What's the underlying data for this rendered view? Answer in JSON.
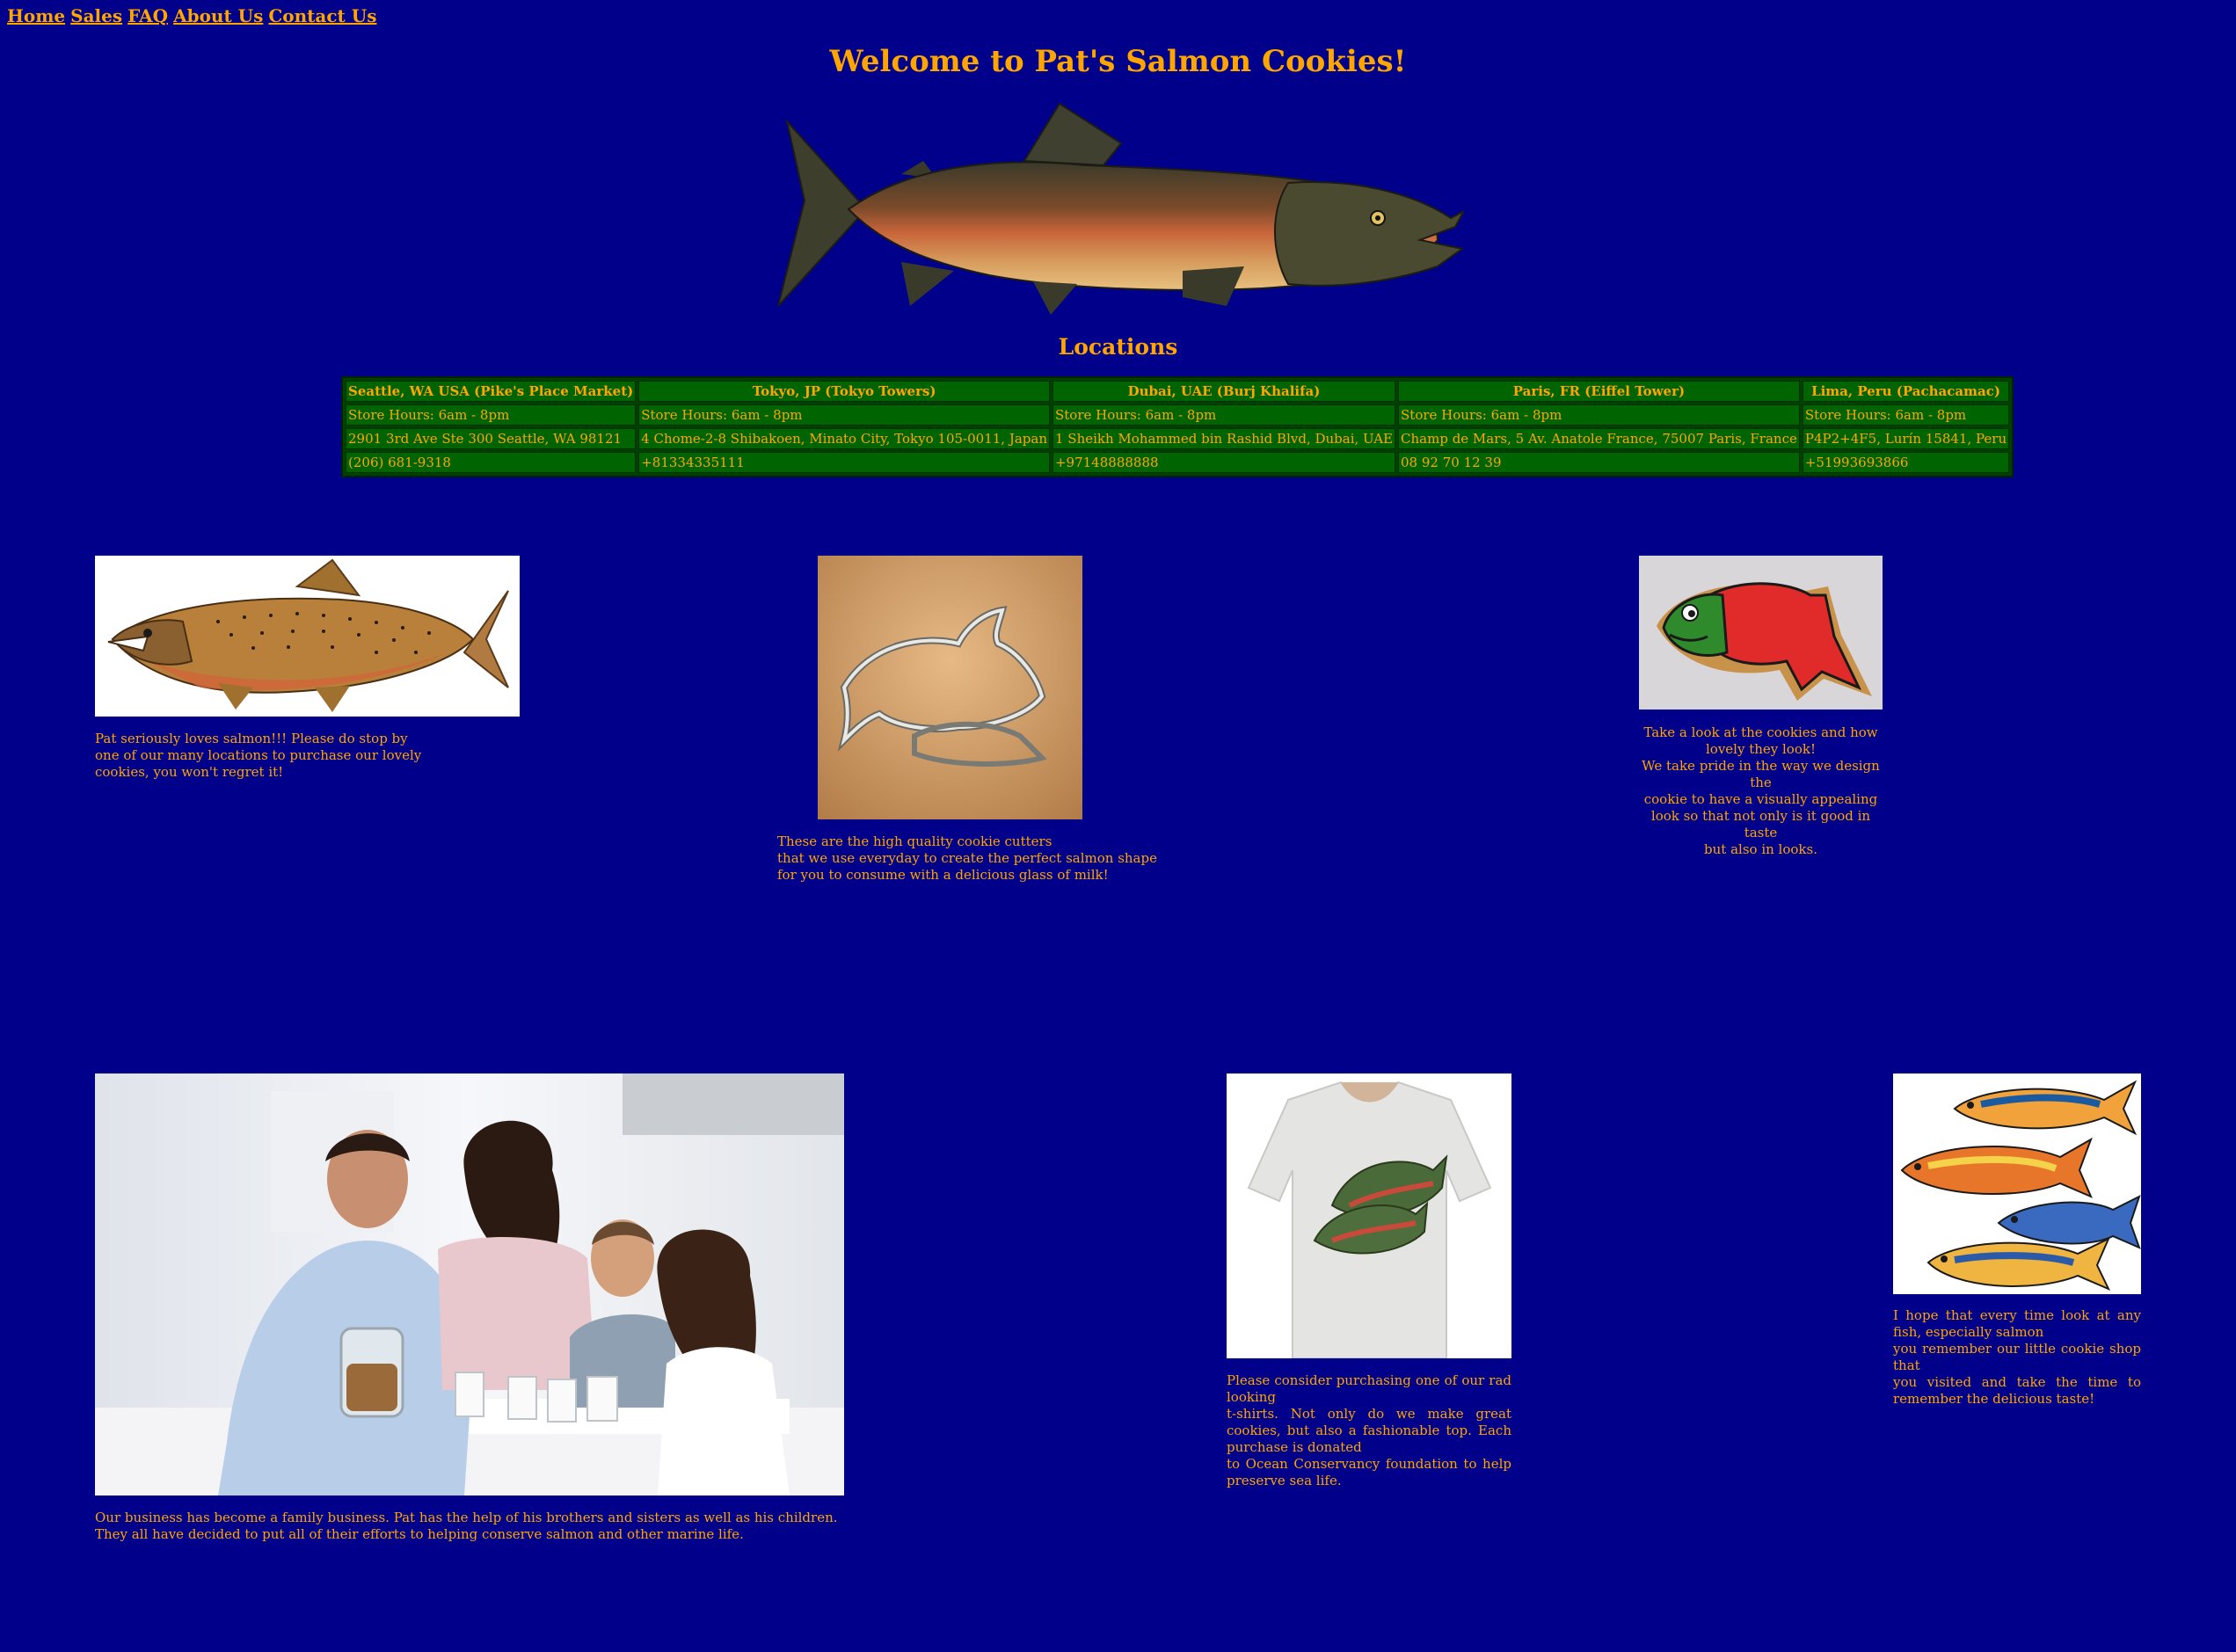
{
  "nav": {
    "links": [
      "Home",
      "Sales",
      "FAQ",
      "About Us",
      "Contact Us"
    ]
  },
  "header": {
    "title": "Welcome to Pat's Salmon Cookies!"
  },
  "locations": {
    "title": "Locations",
    "stores": [
      {
        "name": "Seattle, WA USA (Pike's Place Market)",
        "hours": "Store Hours: 6am - 8pm",
        "address": "2901 3rd Ave Ste 300 Seattle, WA 98121",
        "phone": "(206) 681-9318"
      },
      {
        "name": "Tokyo, JP (Tokyo Towers)",
        "hours": "Store Hours: 6am - 8pm",
        "address": "4 Chome-2-8 Shibakoen, Minato City, Tokyo 105-0011, Japan",
        "phone": "+81334335111"
      },
      {
        "name": "Dubai, UAE (Burj Khalifa)",
        "hours": "Store Hours: 6am - 8pm",
        "address": "1 Sheikh Mohammed bin Rashid Blvd, Dubai, UAE",
        "phone": "+97148888888"
      },
      {
        "name": "Paris, FR (Eiffel Tower)",
        "hours": "Store Hours: 6am - 8pm",
        "address": "Champ de Mars, 5 Av. Anatole France, 75007 Paris, France",
        "phone": "08 92 70 12 39"
      },
      {
        "name": "Lima, Peru (Pachacamac)",
        "hours": "Store Hours: 6am - 8pm",
        "address": "P4P2+4F5, Lurín 15841, Peru",
        "phone": "+51993693866"
      }
    ]
  },
  "gallery": {
    "salmon_caption": "Pat seriously loves salmon!!! Please do stop by\none of our many locations to purchase our lovely\ncookies, you won't regret it!",
    "cutter_caption": "These are the high quality cookie cutters\nthat we use everyday to create the perfect salmon shape\nfor you to consume with a delicious glass of milk!",
    "cookie_caption": "Take a look at the cookies and how\nlovely they look!\nWe take pride in the way we design the\ncookie to have a visually appealing\nlook so that not only is it good in taste\nbut also in looks.",
    "family_caption": "Our business has become a family business. Pat has the help of his brothers and sisters as well as his children.\nThey all have decided to put all of their efforts to helping conserve salmon and other marine life.",
    "tshirt_caption": "Please consider purchasing one of our rad looking\nt-shirts. Not only do we make great cookies, but also a fashionable top. Each purchase is donated\nto Ocean Conservancy foundation to help preserve sea life.",
    "fish_art_caption": "I hope that every time look at any fish, especially salmon\nyou remember our little cookie shop that\nyou visited and take the time to remember the delicious taste!"
  },
  "colors": {
    "background": "#00008b",
    "text": "#ffa500",
    "table_cell": "#006400"
  }
}
